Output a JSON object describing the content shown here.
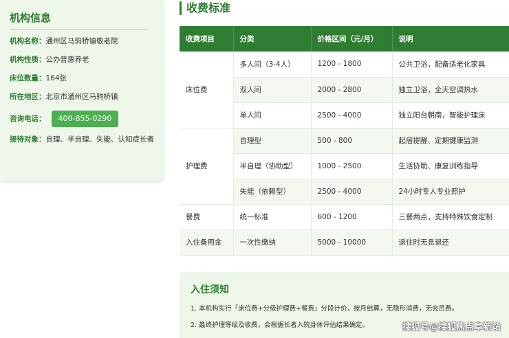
{
  "info": {
    "title": "机构信息",
    "rows": [
      {
        "label": "机构名称：",
        "value": "通州区马驹桥镇敬老院"
      },
      {
        "label": "机构性质：",
        "value": "公办普惠养老"
      },
      {
        "label": "床位数量：",
        "value": "164张"
      },
      {
        "label": "所在地区：",
        "value": "北京市通州区马驹桥镇"
      }
    ],
    "phone_label": "咨询电话：",
    "phone": "400-855-0290",
    "target_label": "接待对象：",
    "target_value": "自理、半自理、失能、认知症长者"
  },
  "fees": {
    "title": "收费标准",
    "headers": [
      "收费项目",
      "分类",
      "价格区间（元/月）",
      "说明"
    ],
    "groups": [
      {
        "category": "床位费",
        "rows": [
          {
            "type": "多人间（3-4人）",
            "price": "1200 - 1800",
            "note": "公共卫浴，配备适老化家具"
          },
          {
            "type": "双人间",
            "price": "2000 - 2800",
            "note": "独立卫浴，全天空调热水"
          },
          {
            "type": "单人间",
            "price": "2500 - 4000",
            "note": "独立阳台朝南，智能护理床"
          }
        ]
      },
      {
        "category": "护理费",
        "rows": [
          {
            "type": "自理型",
            "price": "500 - 800",
            "note": "起居提醒、定期健康监测"
          },
          {
            "type": "半自理（协助型）",
            "price": "1000 - 2500",
            "note": "生活协助、康复训练指导"
          },
          {
            "type": "失能（依赖型）",
            "price": "2500 - 4000",
            "note": "24小时专人专业照护"
          }
        ]
      },
      {
        "category": "餐费",
        "rows": [
          {
            "type": "统一标准",
            "price": "600 - 1200",
            "note": "三餐两点，支持特殊饮食定制"
          }
        ]
      },
      {
        "category": "入住备用金",
        "rows": [
          {
            "type": "一次性缴纳",
            "price": "5000 - 10000",
            "note": "退住时无息退还"
          }
        ]
      }
    ]
  },
  "notice": {
    "title": "入住须知",
    "items": [
      "1. 本机构实行「床位费+分级护理费+餐费」分段计价，按月结算，无隐形消费，无会员费。",
      "2. 最终护理等级及收费，会根据长者入院身体评估结果确定。"
    ]
  },
  "watermark": "搜狐号@搜狐焦点阜新站"
}
